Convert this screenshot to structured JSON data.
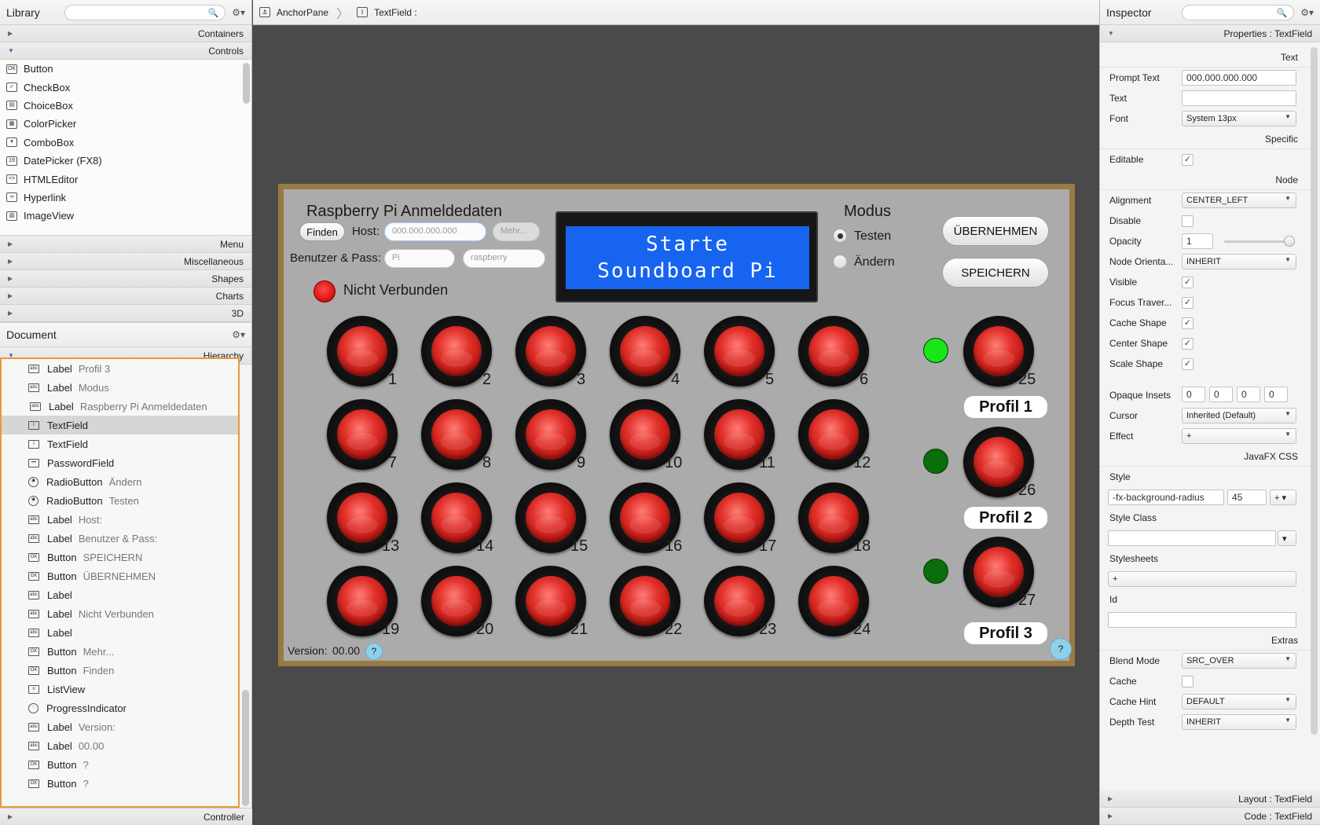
{
  "library": {
    "title": "Library",
    "sections_top": [
      "Containers",
      "Controls"
    ],
    "controls": [
      {
        "label": "Button",
        "icon": "OK"
      },
      {
        "label": "CheckBox",
        "icon": "✓"
      },
      {
        "label": "ChoiceBox",
        "icon": "▤"
      },
      {
        "label": "ColorPicker",
        "icon": "▦"
      },
      {
        "label": "ComboBox",
        "icon": "▾"
      },
      {
        "label": "DatePicker  (FX8)",
        "icon": "19"
      },
      {
        "label": "HTMLEditor",
        "icon": "<>"
      },
      {
        "label": "Hyperlink",
        "icon": "∞"
      },
      {
        "label": "ImageView",
        "icon": "▨"
      }
    ],
    "sections_bottom": [
      "Menu",
      "Miscellaneous",
      "Shapes",
      "Charts",
      "3D"
    ]
  },
  "document": {
    "title": "Document",
    "hierarchy_label": "Hierarchy",
    "items": [
      {
        "type": "Label",
        "value": "Profil 3",
        "icon": "abc"
      },
      {
        "type": "Label",
        "value": "Modus",
        "icon": "abc"
      },
      {
        "type": "Label",
        "value": "Raspberry Pi Anmeldedaten",
        "icon": "abc"
      },
      {
        "type": "TextField",
        "value": "",
        "icon": "I",
        "selected": true
      },
      {
        "type": "TextField",
        "value": "",
        "icon": "I"
      },
      {
        "type": "PasswordField",
        "value": "",
        "icon": "•••"
      },
      {
        "type": "RadioButton",
        "value": "Ändern",
        "icon": "◉"
      },
      {
        "type": "RadioButton",
        "value": "Testen",
        "icon": "◉"
      },
      {
        "type": "Label",
        "value": "Host:",
        "icon": "abc"
      },
      {
        "type": "Label",
        "value": "Benutzer & Pass:",
        "icon": "abc"
      },
      {
        "type": "Button",
        "value": "SPEICHERN",
        "icon": "OK"
      },
      {
        "type": "Button",
        "value": "ÜBERNEHMEN",
        "icon": "OK"
      },
      {
        "type": "Label",
        "value": "",
        "icon": "abc"
      },
      {
        "type": "Label",
        "value": "Nicht Verbunden",
        "icon": "abc"
      },
      {
        "type": "Label",
        "value": "",
        "icon": "abc"
      },
      {
        "type": "Button",
        "value": "Mehr...",
        "icon": "OK"
      },
      {
        "type": "Button",
        "value": "Finden",
        "icon": "OK"
      },
      {
        "type": "ListView",
        "value": "",
        "icon": "≡"
      },
      {
        "type": "ProgressIndicator",
        "value": "",
        "icon": "◌"
      },
      {
        "type": "Label",
        "value": "Version:",
        "icon": "abc"
      },
      {
        "type": "Label",
        "value": "00.00",
        "icon": "abc"
      },
      {
        "type": "Button",
        "value": "?",
        "icon": "OK"
      },
      {
        "type": "Button",
        "value": "?",
        "icon": "OK"
      }
    ],
    "controller_label": "Controller"
  },
  "breadcrumb": {
    "root": "AnchorPane",
    "current": "TextField :"
  },
  "inspector": {
    "title": "Inspector",
    "properties_header": "Properties : TextField",
    "sections": {
      "text": "Text",
      "specific": "Specific",
      "node": "Node",
      "css": "JavaFX CSS",
      "extras": "Extras"
    },
    "text_props": [
      {
        "label": "Prompt Text",
        "value": "000.000.000.000",
        "kind": "input"
      },
      {
        "label": "Text",
        "value": "",
        "kind": "input"
      },
      {
        "label": "Font",
        "value": "System 13px",
        "kind": "select"
      }
    ],
    "specific_props": [
      {
        "label": "Editable",
        "value": "✓",
        "kind": "check"
      }
    ],
    "node_props": [
      {
        "label": "Alignment",
        "value": "CENTER_LEFT",
        "kind": "select"
      },
      {
        "label": "Disable",
        "value": "",
        "kind": "check"
      },
      {
        "label": "Opacity",
        "value": "1",
        "kind": "opacity"
      },
      {
        "label": "Node Orienta...",
        "value": "INHERIT",
        "kind": "select"
      },
      {
        "label": "Visible",
        "value": "✓",
        "kind": "check"
      },
      {
        "label": "Focus Traver...",
        "value": "✓",
        "kind": "check"
      },
      {
        "label": "Cache Shape",
        "value": "✓",
        "kind": "check"
      },
      {
        "label": "Center Shape",
        "value": "✓",
        "kind": "check"
      },
      {
        "label": "Scale Shape",
        "value": "✓",
        "kind": "check"
      }
    ],
    "opaque_insets": {
      "label": "Opaque Insets",
      "values": [
        "0",
        "0",
        "0",
        "0"
      ]
    },
    "node_props2": [
      {
        "label": "Cursor",
        "value": "Inherited (Default)",
        "kind": "select"
      },
      {
        "label": "Effect",
        "value": "+",
        "kind": "select"
      }
    ],
    "style_label": "Style",
    "style_prop": "-fx-background-radius",
    "style_value": "45",
    "style_class_label": "Style Class",
    "stylesheets_label": "Stylesheets",
    "stylesheets_add": "+",
    "id_label": "Id",
    "extras_props": [
      {
        "label": "Blend Mode",
        "value": "SRC_OVER",
        "kind": "select"
      },
      {
        "label": "Cache",
        "value": "",
        "kind": "check"
      },
      {
        "label": "Cache Hint",
        "value": "DEFAULT",
        "kind": "select"
      },
      {
        "label": "Depth Test",
        "value": "INHERIT",
        "kind": "select"
      }
    ],
    "layout_footer": "Layout : TextField",
    "code_footer": "Code : TextField"
  },
  "app": {
    "creds_title": "Raspberry Pi Anmeldedaten",
    "find_btn": "Finden",
    "host_label": "Host:",
    "host_placeholder": "000.000.000.000",
    "more_btn": "Mehr...",
    "user_label": "Benutzer & Pass:",
    "user_placeholder": "Pi",
    "pass_placeholder": "raspberry",
    "status_text": "Nicht Verbunden",
    "status_color": "#e01818",
    "lcd_line1": "Starte",
    "lcd_line2": "Soundboard Pi",
    "lcd_color": "#1764f0",
    "mode_title": "Modus",
    "mode_test": "Testen",
    "mode_change": "Ändern",
    "mode_selected": "Testen",
    "apply_btn": "ÜBERNEHMEN",
    "save_btn": "SPEICHERN",
    "pads": [
      "1",
      "2",
      "3",
      "4",
      "5",
      "6",
      "7",
      "8",
      "9",
      "10",
      "11",
      "12",
      "13",
      "14",
      "15",
      "16",
      "17",
      "18",
      "19",
      "20",
      "21",
      "22",
      "23",
      "24"
    ],
    "profiles": [
      {
        "name": "Profil 1",
        "pad": "25",
        "led_color": "#19e619",
        "active": true
      },
      {
        "name": "Profil 2",
        "pad": "26",
        "led_color": "#0a6e0a",
        "active": false
      },
      {
        "name": "Profil 3",
        "pad": "27",
        "led_color": "#0a6e0a",
        "active": false
      }
    ],
    "version_label": "Version:",
    "version_value": "00.00",
    "help_glyph": "?"
  }
}
